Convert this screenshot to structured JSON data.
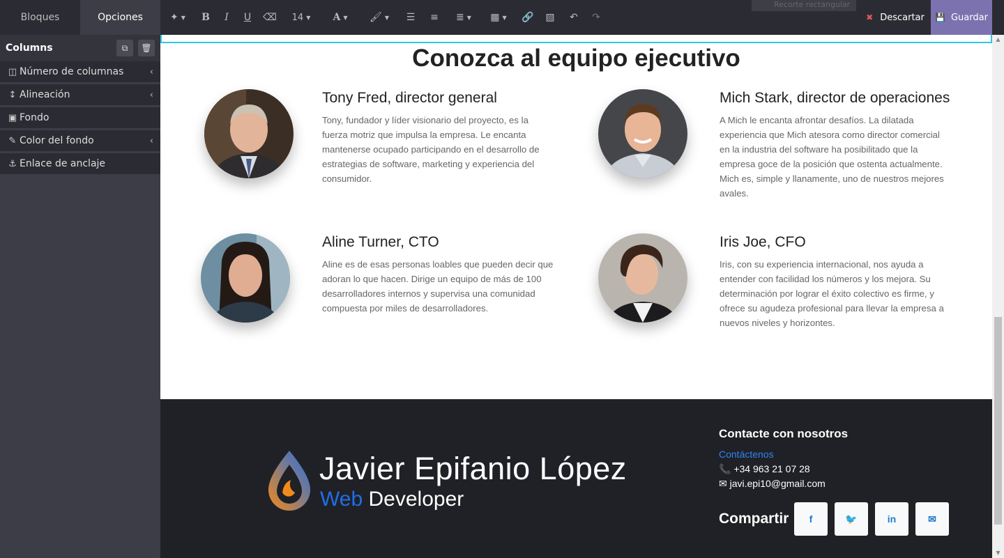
{
  "sidebar": {
    "tabs": [
      {
        "label": "Bloques"
      },
      {
        "label": "Opciones"
      }
    ],
    "header": {
      "title": "Columns"
    },
    "rows": [
      {
        "label": "Número de columnas",
        "icon": "columns-icon"
      },
      {
        "label": "Alineación",
        "icon": "height-icon"
      },
      {
        "label": "Fondo",
        "icon": "image-icon"
      },
      {
        "label": "Color del fondo",
        "icon": "eyedropper-icon"
      },
      {
        "label": "Enlace de anclaje",
        "icon": "anchor-icon"
      }
    ]
  },
  "toolbar": {
    "font_size": "14",
    "ghost_label": "Recorte rectangular",
    "discard_label": "Descartar",
    "save_label": "Guardar"
  },
  "main": {
    "title": "Conozca al equipo ejecutivo",
    "members": [
      {
        "name": "Tony Fred, director general",
        "bio_lines": [
          "Tony, fundador y líder visionario del proyecto, es la",
          "fuerza motriz que impulsa la empresa. Le encanta",
          "mantenerse ocupado participando en el desarrollo de",
          "estrategias de software, marketing y experiencia del",
          "consumidor."
        ]
      },
      {
        "name": "Mich Stark, director de operaciones",
        "bio_lines": [
          "A Mich le encanta afrontar desafíos. La dilatada",
          "experiencia que Mich atesora como director comercial",
          "en la industria del software ha posibilitado que la",
          "empresa goce de la posición que ostenta actualmente.",
          "Mich es, simple y llanamente, uno de nuestros mejores",
          "avales."
        ]
      },
      {
        "name": "Aline Turner, CTO",
        "bio_lines": [
          "Aline es de esas personas loables que pueden decir que",
          "adoran lo que hacen. Dirige un equipo de más de 100",
          "desarrolladores internos y supervisa una comunidad",
          "compuesta por miles de desarrolladores."
        ]
      },
      {
        "name": "Iris Joe, CFO",
        "bio_lines": [
          "Iris, con su experiencia internacional, nos ayuda a",
          "entender con facilidad los números y los mejora. Su",
          "determinación por lograr el éxito colectivo es firme, y",
          "ofrece su agudeza profesional para llevar la empresa a",
          "nuevos niveles y horizontes."
        ]
      }
    ]
  },
  "footer": {
    "logo_name": "Javier Epifanio López",
    "logo_role_a": "Web",
    "logo_role_b": "Developer",
    "contact_title": "Contacte con nosotros",
    "contact_link": "Contáctenos",
    "phone": "+34 963 21 07 28",
    "email": "javi.epi10@gmail.com",
    "share_title": "Compartir",
    "share": [
      {
        "label": "f",
        "icon": "facebook-icon"
      },
      {
        "label": "🐦",
        "icon": "twitter-icon"
      },
      {
        "label": "in",
        "icon": "linkedin-icon"
      },
      {
        "label": "✉",
        "icon": "mail-icon"
      }
    ]
  },
  "colors": {
    "sidebar_bg": "#3c3d46",
    "toolbar_bg": "#2b2c33",
    "save_bg": "#7c72b0",
    "selection": "#2ec7e6",
    "footer_bg": "#202126",
    "link": "#2d84f5",
    "logo_orange": "#f28a1a",
    "logo_blue": "#1f6ee8"
  }
}
